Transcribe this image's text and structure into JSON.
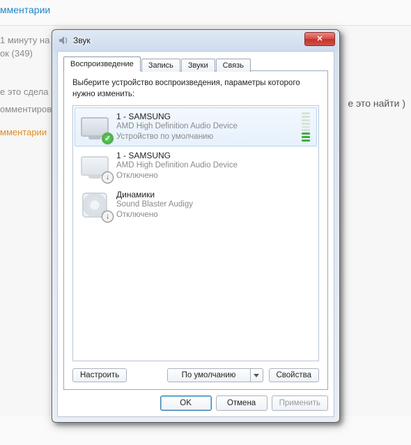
{
  "background": {
    "comments_link_top": "мментарии",
    "line_time": "1 минуту на",
    "line_count": "ок (349)",
    "line_q1": "е это сдела",
    "line_q2": "омментиров",
    "comments_link_side": "мментарии",
    "right_text": "е это найти )"
  },
  "dialog": {
    "title": "Звук",
    "tabs": [
      "Воспроизведение",
      "Запись",
      "Звуки",
      "Связь"
    ],
    "active_tab": 0,
    "instruction": "Выберите устройство воспроизведения, параметры которого нужно изменить:",
    "devices": [
      {
        "name": "1 - SAMSUNG",
        "line2": "AMD High Definition Audio Device",
        "line3": "Устройство по умолчанию",
        "icon": "monitor",
        "badge": "check",
        "selected": true,
        "meter": true,
        "meter_level": 3
      },
      {
        "name": "1 - SAMSUNG",
        "line2": "AMD High Definition Audio Device",
        "line3": "Отключено",
        "icon": "monitor-dim",
        "badge": "down",
        "selected": false,
        "meter": false
      },
      {
        "name": "Динамики",
        "line2": "Sound Blaster Audigy",
        "line3": "Отключено",
        "icon": "speaker",
        "badge": "down",
        "selected": false,
        "meter": false
      }
    ],
    "panel_buttons": {
      "configure": "Настроить",
      "set_default": "По умолчанию",
      "properties": "Свойства"
    },
    "buttons": {
      "ok": "OK",
      "cancel": "Отмена",
      "apply": "Применить"
    }
  }
}
